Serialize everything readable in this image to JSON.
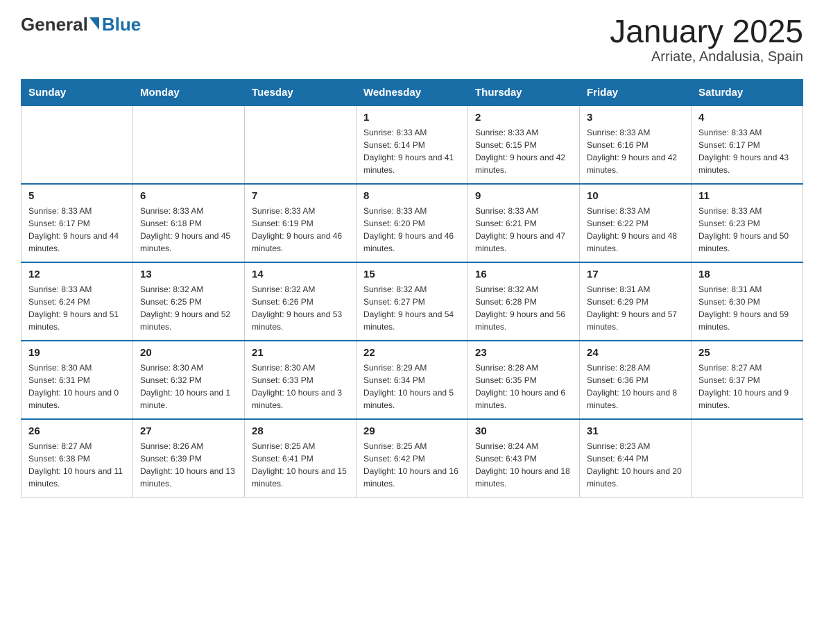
{
  "header": {
    "logo_general": "General",
    "logo_blue": "Blue",
    "title": "January 2025",
    "subtitle": "Arriate, Andalusia, Spain"
  },
  "days_of_week": [
    "Sunday",
    "Monday",
    "Tuesday",
    "Wednesday",
    "Thursday",
    "Friday",
    "Saturday"
  ],
  "weeks": [
    [
      {
        "day": "",
        "info": ""
      },
      {
        "day": "",
        "info": ""
      },
      {
        "day": "",
        "info": ""
      },
      {
        "day": "1",
        "info": "Sunrise: 8:33 AM\nSunset: 6:14 PM\nDaylight: 9 hours and 41 minutes."
      },
      {
        "day": "2",
        "info": "Sunrise: 8:33 AM\nSunset: 6:15 PM\nDaylight: 9 hours and 42 minutes."
      },
      {
        "day": "3",
        "info": "Sunrise: 8:33 AM\nSunset: 6:16 PM\nDaylight: 9 hours and 42 minutes."
      },
      {
        "day": "4",
        "info": "Sunrise: 8:33 AM\nSunset: 6:17 PM\nDaylight: 9 hours and 43 minutes."
      }
    ],
    [
      {
        "day": "5",
        "info": "Sunrise: 8:33 AM\nSunset: 6:17 PM\nDaylight: 9 hours and 44 minutes."
      },
      {
        "day": "6",
        "info": "Sunrise: 8:33 AM\nSunset: 6:18 PM\nDaylight: 9 hours and 45 minutes."
      },
      {
        "day": "7",
        "info": "Sunrise: 8:33 AM\nSunset: 6:19 PM\nDaylight: 9 hours and 46 minutes."
      },
      {
        "day": "8",
        "info": "Sunrise: 8:33 AM\nSunset: 6:20 PM\nDaylight: 9 hours and 46 minutes."
      },
      {
        "day": "9",
        "info": "Sunrise: 8:33 AM\nSunset: 6:21 PM\nDaylight: 9 hours and 47 minutes."
      },
      {
        "day": "10",
        "info": "Sunrise: 8:33 AM\nSunset: 6:22 PM\nDaylight: 9 hours and 48 minutes."
      },
      {
        "day": "11",
        "info": "Sunrise: 8:33 AM\nSunset: 6:23 PM\nDaylight: 9 hours and 50 minutes."
      }
    ],
    [
      {
        "day": "12",
        "info": "Sunrise: 8:33 AM\nSunset: 6:24 PM\nDaylight: 9 hours and 51 minutes."
      },
      {
        "day": "13",
        "info": "Sunrise: 8:32 AM\nSunset: 6:25 PM\nDaylight: 9 hours and 52 minutes."
      },
      {
        "day": "14",
        "info": "Sunrise: 8:32 AM\nSunset: 6:26 PM\nDaylight: 9 hours and 53 minutes."
      },
      {
        "day": "15",
        "info": "Sunrise: 8:32 AM\nSunset: 6:27 PM\nDaylight: 9 hours and 54 minutes."
      },
      {
        "day": "16",
        "info": "Sunrise: 8:32 AM\nSunset: 6:28 PM\nDaylight: 9 hours and 56 minutes."
      },
      {
        "day": "17",
        "info": "Sunrise: 8:31 AM\nSunset: 6:29 PM\nDaylight: 9 hours and 57 minutes."
      },
      {
        "day": "18",
        "info": "Sunrise: 8:31 AM\nSunset: 6:30 PM\nDaylight: 9 hours and 59 minutes."
      }
    ],
    [
      {
        "day": "19",
        "info": "Sunrise: 8:30 AM\nSunset: 6:31 PM\nDaylight: 10 hours and 0 minutes."
      },
      {
        "day": "20",
        "info": "Sunrise: 8:30 AM\nSunset: 6:32 PM\nDaylight: 10 hours and 1 minute."
      },
      {
        "day": "21",
        "info": "Sunrise: 8:30 AM\nSunset: 6:33 PM\nDaylight: 10 hours and 3 minutes."
      },
      {
        "day": "22",
        "info": "Sunrise: 8:29 AM\nSunset: 6:34 PM\nDaylight: 10 hours and 5 minutes."
      },
      {
        "day": "23",
        "info": "Sunrise: 8:28 AM\nSunset: 6:35 PM\nDaylight: 10 hours and 6 minutes."
      },
      {
        "day": "24",
        "info": "Sunrise: 8:28 AM\nSunset: 6:36 PM\nDaylight: 10 hours and 8 minutes."
      },
      {
        "day": "25",
        "info": "Sunrise: 8:27 AM\nSunset: 6:37 PM\nDaylight: 10 hours and 9 minutes."
      }
    ],
    [
      {
        "day": "26",
        "info": "Sunrise: 8:27 AM\nSunset: 6:38 PM\nDaylight: 10 hours and 11 minutes."
      },
      {
        "day": "27",
        "info": "Sunrise: 8:26 AM\nSunset: 6:39 PM\nDaylight: 10 hours and 13 minutes."
      },
      {
        "day": "28",
        "info": "Sunrise: 8:25 AM\nSunset: 6:41 PM\nDaylight: 10 hours and 15 minutes."
      },
      {
        "day": "29",
        "info": "Sunrise: 8:25 AM\nSunset: 6:42 PM\nDaylight: 10 hours and 16 minutes."
      },
      {
        "day": "30",
        "info": "Sunrise: 8:24 AM\nSunset: 6:43 PM\nDaylight: 10 hours and 18 minutes."
      },
      {
        "day": "31",
        "info": "Sunrise: 8:23 AM\nSunset: 6:44 PM\nDaylight: 10 hours and 20 minutes."
      },
      {
        "day": "",
        "info": ""
      }
    ]
  ]
}
